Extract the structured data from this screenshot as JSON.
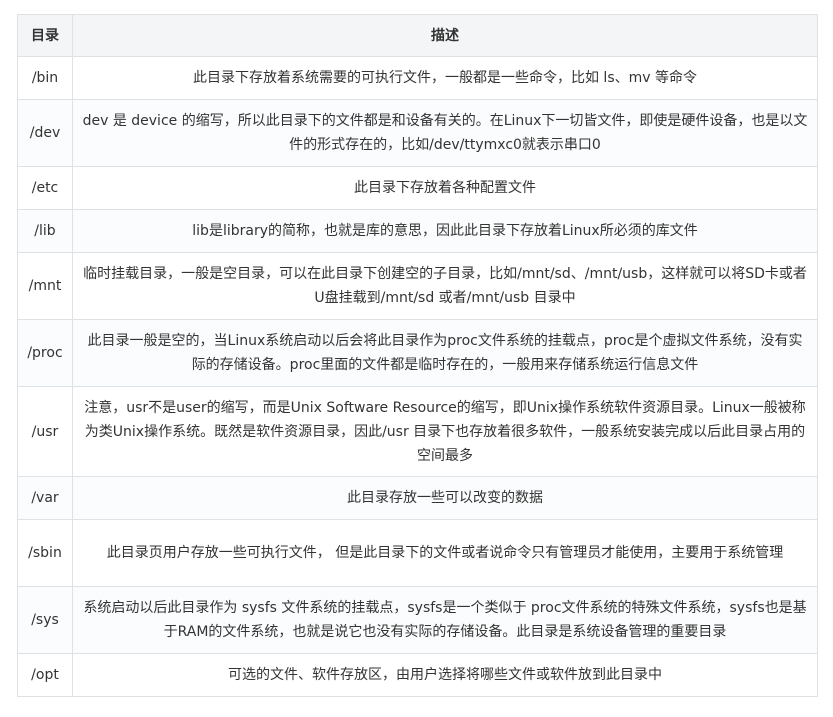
{
  "table": {
    "headers": [
      "目录",
      "描述"
    ],
    "rows": [
      {
        "dir": "/bin",
        "desc": "此目录下存放着系统需要的可执行文件，一般都是一些命令，比如 ls、mv 等命令"
      },
      {
        "dir": "/dev",
        "desc": "dev 是 device 的缩写，所以此目录下的文件都是和设备有关的。在Linux下一切皆文件，即使是硬件设备，也是以文件的形式存在的，比如/dev/ttymxc0就表示串口0"
      },
      {
        "dir": "/etc",
        "desc": "此目录下存放着各种配置文件"
      },
      {
        "dir": "/lib",
        "desc": "lib是library的简称，也就是库的意思，因此此目录下存放着Linux所必须的库文件"
      },
      {
        "dir": "/mnt",
        "desc": "临时挂载目录，一般是空目录，可以在此目录下创建空的子目录，比如/mnt/sd、/mnt/usb，这样就可以将SD卡或者U盘挂载到/mnt/sd 或者/mnt/usb 目录中"
      },
      {
        "dir": "/proc",
        "desc": "此目录一般是空的，当Linux系统启动以后会将此目录作为proc文件系统的挂载点，proc是个虚拟文件系统，没有实际的存储设备。proc里面的文件都是临时存在的，一般用来存储系统运行信息文件"
      },
      {
        "dir": "/usr",
        "desc": "注意，usr不是user的缩写，而是Unix Software Resource的缩写，即Unix操作系统软件资源目录。Linux一般被称为类Unix操作系统。既然是软件资源目录，因此/usr 目录下也存放着很多软件，一般系统安装完成以后此目录占用的空间最多"
      },
      {
        "dir": "/var",
        "desc": "此目录存放一些可以改变的数据"
      },
      {
        "dir": "/sbin",
        "desc": "此目录页用户存放一些可执行文件， 但是此目录下的文件或者说命令只有管理员才能使用，主要用于系统管理"
      },
      {
        "dir": "/sys",
        "desc": "系统启动以后此目录作为 sysfs 文件系统的挂载点，sysfs是一个类似于 proc文件系统的特殊文件系统，sysfs也是基于RAM的文件系统，也就是说它也没有实际的存储设备。此目录是系统设备管理的重要目录"
      },
      {
        "dir": "/opt",
        "desc": "可选的文件、软件存放区，由用户选择将哪些文件或软件放到此目录中"
      }
    ]
  }
}
